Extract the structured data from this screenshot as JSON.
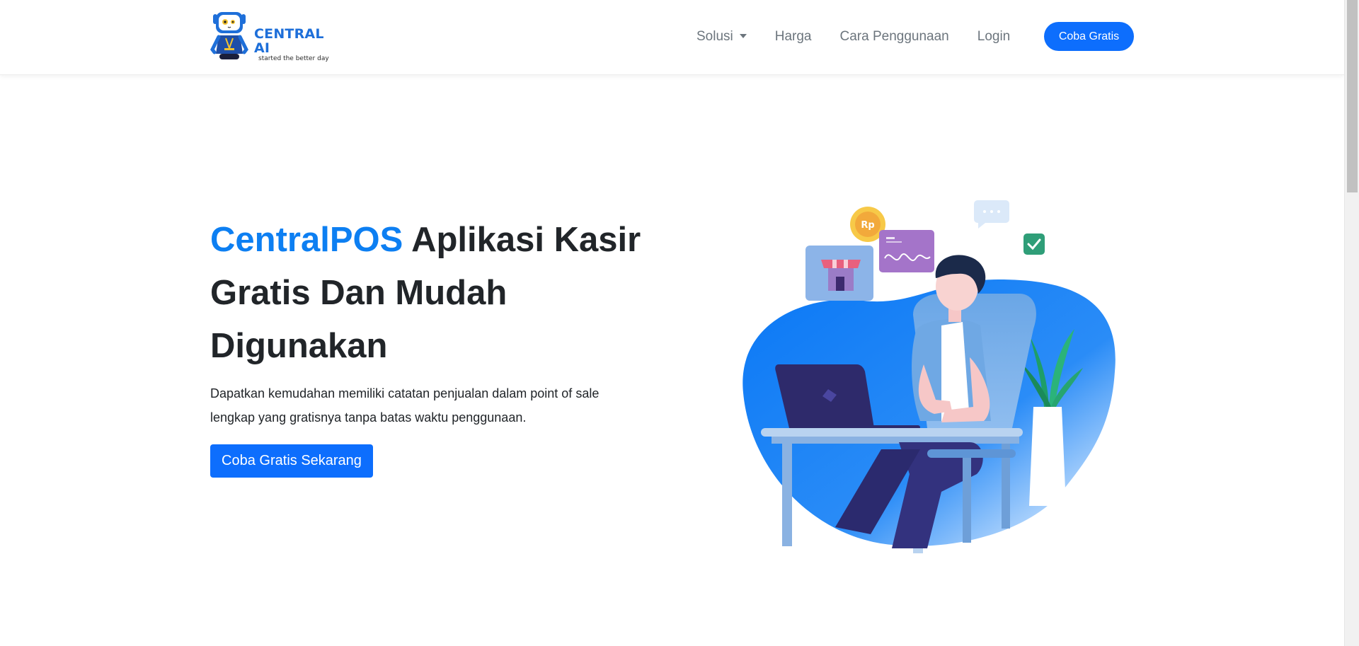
{
  "navbar": {
    "brand": {
      "title": "CENTRAL AI",
      "tagline": "started the better day"
    },
    "links": [
      {
        "label": "Solusi",
        "has_dropdown": true
      },
      {
        "label": "Harga"
      },
      {
        "label": "Cara Penggunaan"
      },
      {
        "label": "Login"
      }
    ],
    "cta_label": "Coba Gratis"
  },
  "hero": {
    "title_accent": "CentralPOS",
    "title_rest": " Aplikasi Kasir Gratis Dan Mudah Digunakan",
    "description": "Dapatkan kemudahan memiliki catatan penjualan dalam point of sale lengkap yang gratisnya tanpa batas waktu penggunaan.",
    "cta_label": "Coba Gratis Sekarang",
    "illustration": {
      "coin_label": "Rp"
    }
  },
  "colors": {
    "primary": "#0d6efd",
    "accent_title": "#0d7ff2",
    "text": "#212529",
    "nav_link": "#6c757d"
  },
  "icons": [
    "robot-logo-icon",
    "caret-down-icon",
    "store-icon",
    "coin-icon",
    "chat-bubble-icon",
    "check-icon",
    "chart-card-icon"
  ]
}
